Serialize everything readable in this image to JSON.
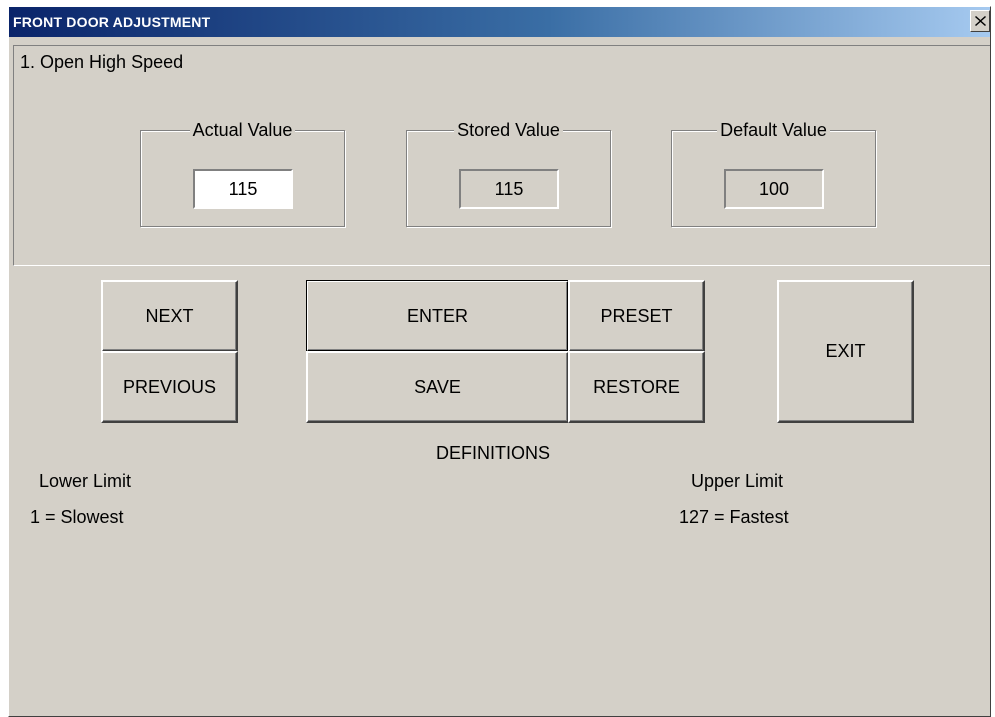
{
  "window": {
    "title": "FRONT DOOR ADJUSTMENT"
  },
  "parameter": {
    "title": "1. Open High Speed"
  },
  "values": {
    "actual": {
      "label": "Actual Value",
      "value": "115"
    },
    "stored": {
      "label": "Stored Value",
      "value": "115"
    },
    "default": {
      "label": "Default Value",
      "value": "100"
    }
  },
  "buttons": {
    "next": "NEXT",
    "previous": "PREVIOUS",
    "enter": "ENTER",
    "save": "SAVE",
    "preset": "PRESET",
    "restore": "RESTORE",
    "exit": "EXIT"
  },
  "definitions": {
    "heading": "DEFINITIONS",
    "lower_label": "Lower Limit",
    "lower_value": "1 = Slowest",
    "upper_label": "Upper Limit",
    "upper_value": "127 = Fastest"
  },
  "icons": {
    "close": "close-icon"
  }
}
